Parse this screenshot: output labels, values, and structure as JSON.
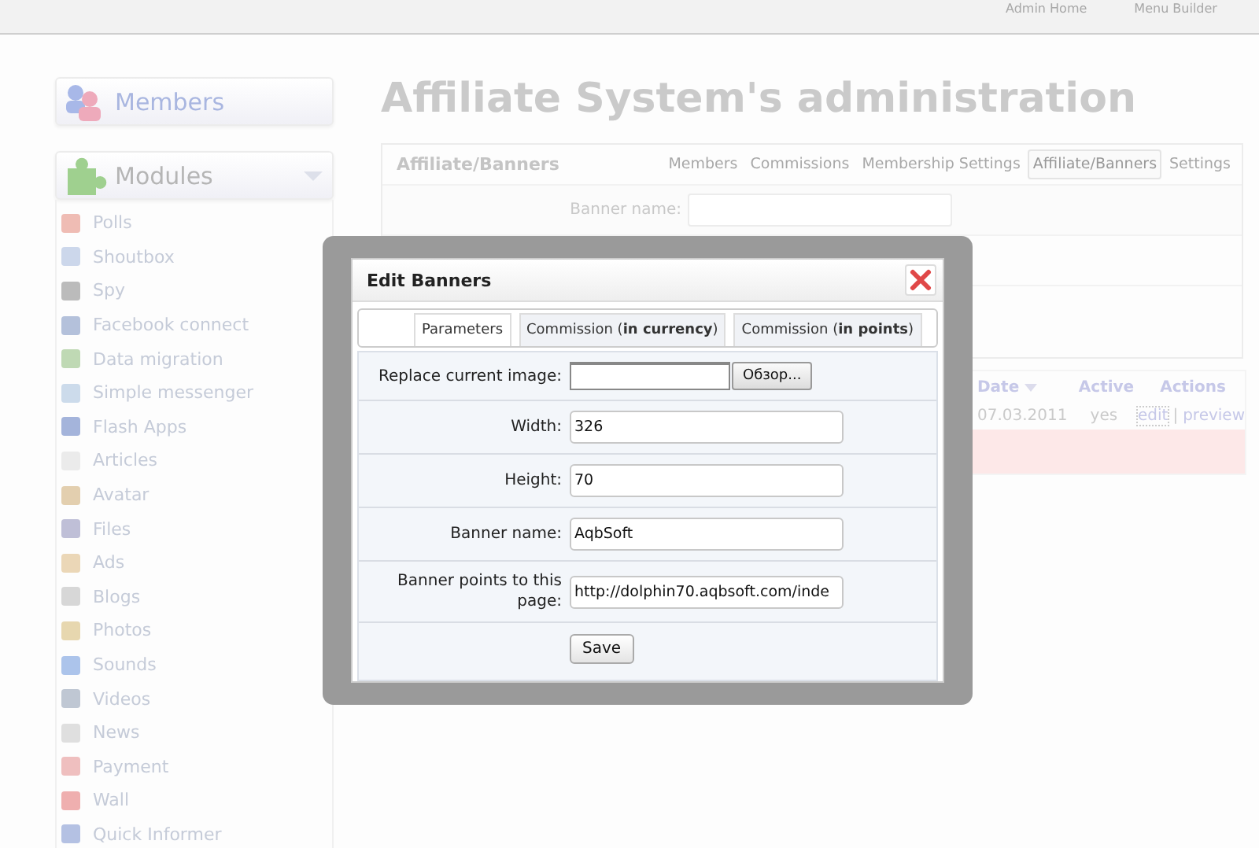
{
  "top_links": [
    "Admin Home",
    "Menu Builder"
  ],
  "sidebar": {
    "members": {
      "label": "Members"
    },
    "modules": {
      "label": "Modules",
      "expanded": true
    },
    "items": [
      {
        "label": "Polls",
        "color": "#efbcb4"
      },
      {
        "label": "Shoutbox",
        "color": "#ccd7eb"
      },
      {
        "label": "Spy",
        "color": "#bbbbbb"
      },
      {
        "label": "Facebook connect",
        "color": "#b4c1db"
      },
      {
        "label": "Data migration",
        "color": "#bfd9b4"
      },
      {
        "label": "Simple messenger",
        "color": "#ccdbeb"
      },
      {
        "label": "Flash Apps",
        "color": "#a4b4db"
      },
      {
        "label": "Articles",
        "color": "#ebebeb"
      },
      {
        "label": "Avatar",
        "color": "#e3cfaf"
      },
      {
        "label": "Files",
        "color": "#bfbfd7"
      },
      {
        "label": "Ads",
        "color": "#ebd7b7"
      },
      {
        "label": "Blogs",
        "color": "#d7d7d7"
      },
      {
        "label": "Photos",
        "color": "#e7d7af"
      },
      {
        "label": "Sounds",
        "color": "#acc4eb"
      },
      {
        "label": "Videos",
        "color": "#bfc7d3"
      },
      {
        "label": "News",
        "color": "#dfdfdf"
      },
      {
        "label": "Payment",
        "color": "#efbfbf"
      },
      {
        "label": "Wall",
        "color": "#efafaf"
      },
      {
        "label": "Quick Informer",
        "color": "#b4c1e3"
      }
    ]
  },
  "main": {
    "title": "Affiliate System's administration",
    "panel": {
      "title": "Affiliate/Banners",
      "tabs": [
        {
          "label": "Members",
          "selected": false
        },
        {
          "label": "Commissions",
          "selected": false
        },
        {
          "label": "Membership Settings",
          "selected": false
        },
        {
          "label": "Affiliate/Banners",
          "selected": true
        },
        {
          "label": "Settings",
          "selected": false
        }
      ],
      "field_label": "Banner name:"
    },
    "table": {
      "columns": [
        "Date",
        "Active",
        "Actions"
      ],
      "rows": [
        {
          "date": "07.03.2011",
          "active": "yes",
          "actions": [
            "edit",
            "preview"
          ],
          "separator": "|"
        }
      ]
    }
  },
  "dialog": {
    "title": "Edit Banners",
    "tabs": [
      {
        "label": "Parameters",
        "selected": true
      },
      {
        "label": "Commission (**in currency**)",
        "selected": false
      },
      {
        "label": "Commission (**in points**)",
        "selected": false
      }
    ],
    "file_field": {
      "label": "Replace current image:",
      "button": "Обзор..."
    },
    "fields": [
      {
        "label": "Width:",
        "value": "326"
      },
      {
        "label": "Height:",
        "value": "70"
      },
      {
        "label": "Banner name:",
        "value": "AqbSoft"
      },
      {
        "label": "Banner points to this page:",
        "value": "http://dolphin70.aqbsoft.com/inde"
      }
    ],
    "save": "Save"
  }
}
